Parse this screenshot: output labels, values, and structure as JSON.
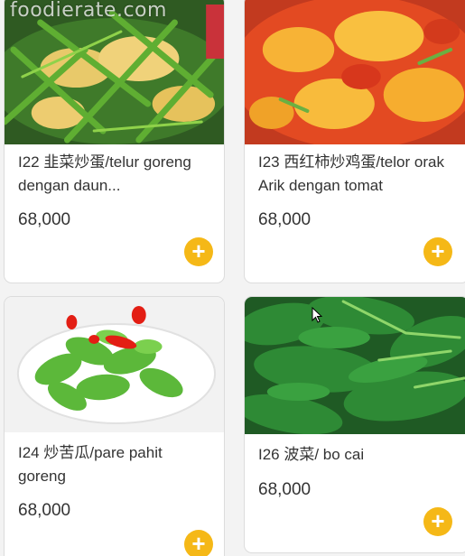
{
  "watermark": "foodierate.com",
  "colors": {
    "accent": "#f5b817",
    "text": "#333333",
    "card_border": "#dcdcdc"
  },
  "items": [
    {
      "title": "I22 韭菜炒蛋/telur goreng dengan daun...",
      "price": "68,000",
      "image": "chives-egg-dish"
    },
    {
      "title": "I23 西红柿炒鸡蛋/telor orak Arik dengan tomat",
      "price": "68,000",
      "image": "tomato-egg-dish"
    },
    {
      "title": "I24 炒苦瓜/pare pahit goreng",
      "price": "68,000",
      "image": "bitter-melon-dish"
    },
    {
      "title": "I26 波菜/ bo cai",
      "price": "68,000",
      "image": "spinach-dish"
    }
  ],
  "add_button": {
    "icon": "plus-icon",
    "glyph": "+"
  }
}
